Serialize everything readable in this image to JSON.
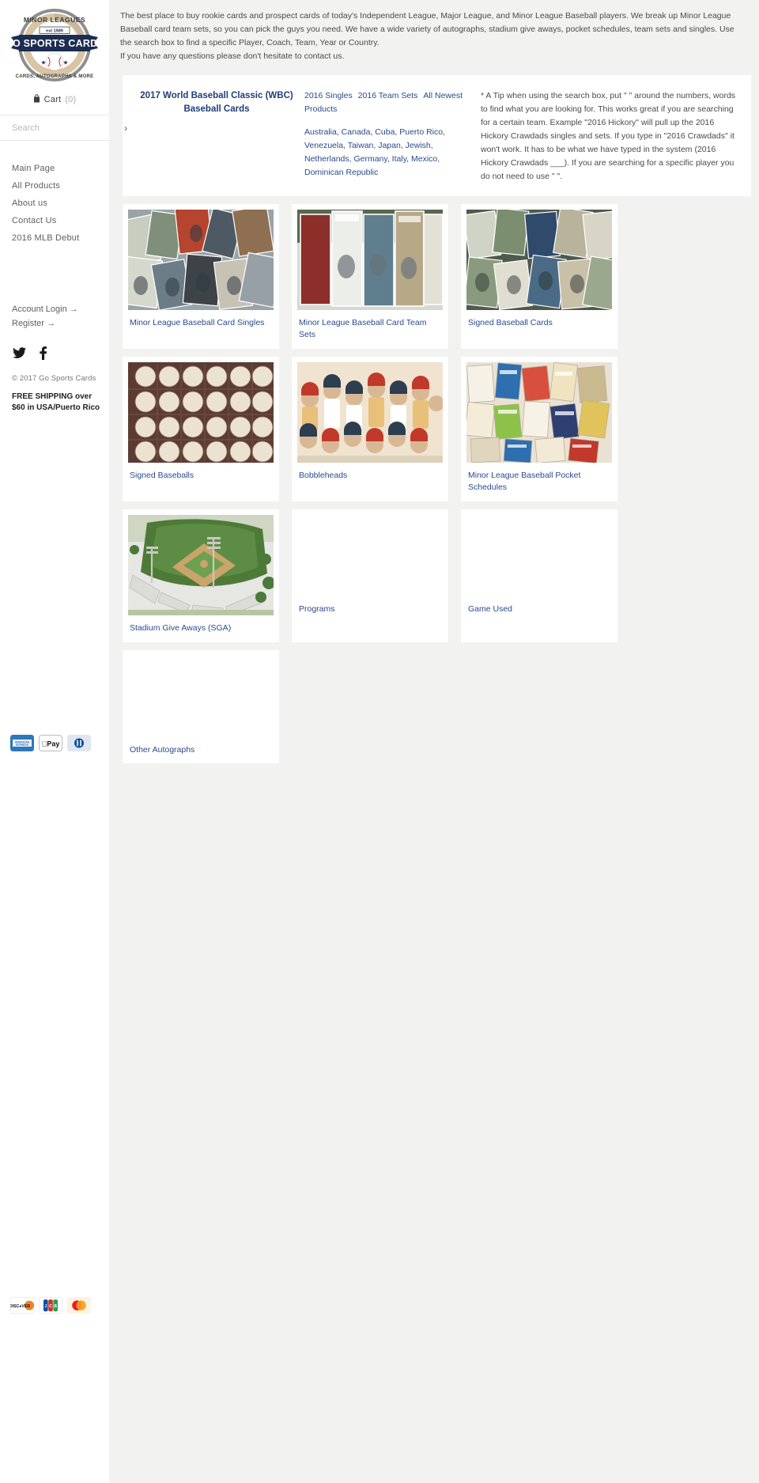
{
  "sidebar": {
    "logo": {
      "top_arc": "MINOR LEAGUES",
      "est": "est 1989",
      "name": "GO SPORTS CARDS",
      "bottom_arc": "CARDS, AUTOGRAPHS & MORE"
    },
    "cart": {
      "label": "Cart",
      "count": "(0)",
      "icon": "shopping-bag-icon"
    },
    "search": {
      "placeholder": "Search",
      "value": "",
      "go_icon": "chevron-right-icon"
    },
    "nav": [
      {
        "label": "Main Page"
      },
      {
        "label": "All Products"
      },
      {
        "label": "About us"
      },
      {
        "label": "Contact Us"
      },
      {
        "label": "2016 MLB Debut"
      }
    ],
    "account": [
      {
        "label": "Account Login →"
      },
      {
        "label": "Register →"
      }
    ],
    "social": [
      {
        "name": "twitter-icon"
      },
      {
        "name": "facebook-icon"
      }
    ],
    "copyright": "© 2017 Go Sports Cards",
    "shipping": "FREE SHIPPING over $60 in USA/Puerto Rico",
    "payments_row1": [
      {
        "name": "american-express-icon",
        "label": "AMERICAN EXPRESS"
      },
      {
        "name": "apple-pay-icon",
        "label": "Pay"
      },
      {
        "name": "diners-club-icon",
        "label": "Diners Club"
      }
    ],
    "payments_row2": [
      {
        "name": "discover-icon",
        "label": "DISCOVER"
      },
      {
        "name": "jcb-icon",
        "label": "JCB"
      },
      {
        "name": "mastercard-icon",
        "label": "Mastercard"
      }
    ]
  },
  "intro": {
    "line1": "The best place to buy rookie cards and prospect cards of today's Independent League, Major League, and Minor League Baseball players. We break up Minor League Baseball card team sets, so you can pick the guys you need. We have a wide variety of autographs, stadium give aways, pocket schedules, team sets and singles. Use the search box to find a specific Player, Coach, Team, Year or Country.",
    "line2": "If you have any questions please don't hesitate to contact us."
  },
  "panel": {
    "feature_link": "2017 World Baseball Classic (WBC) Baseball Cards",
    "quick_links": [
      {
        "label": "2016 Singles"
      },
      {
        "label": "2016 Team Sets"
      },
      {
        "label": "All Newest Products"
      }
    ],
    "countries": "Australia, Canada, Cuba, Puerto Rico, Venezuela, Taiwan, Japan, Jewish, Netherlands, Germany, Italy, Mexico, Dominican Republic",
    "tip": "* A Tip when using the search box, put \" \" around the numbers, words to find what you are looking for. This works great if you are searching for a certain team.  Example \"2016 Hickory\" will pull up the 2016 Hickory Crawdads singles and sets. If you type in \"2016 Crawdads\" it won't work. It has to be what we have typed in the system (2016 Hickory Crawdads ___). If you are searching for a specific player you do not need to use \" \"."
  },
  "grid": {
    "items": [
      {
        "title": "Minor League Baseball Card Singles",
        "image": "baseball-cards-pile",
        "has_image": true
      },
      {
        "title": "Minor League Baseball Card Team Sets",
        "image": "graded-cards-stack",
        "has_image": true
      },
      {
        "title": "Signed Baseball Cards",
        "image": "signed-cards-spread",
        "has_image": true
      },
      {
        "title": "Signed Baseballs",
        "image": "signed-baseballs-case",
        "has_image": true
      },
      {
        "title": "Bobbleheads",
        "image": "bobblehead-collection",
        "has_image": true
      },
      {
        "title": "Minor League Baseball Pocket Schedules",
        "image": "pocket-schedules",
        "has_image": true
      },
      {
        "title": "Stadium Give Aways (SGA)",
        "image": "baseball-stadium",
        "has_image": true
      },
      {
        "title": "Programs",
        "image": "",
        "has_image": false
      },
      {
        "title": "Game Used",
        "image": "",
        "has_image": false
      },
      {
        "title": "Other Autographs",
        "image": "",
        "has_image": false
      }
    ]
  },
  "colors": {
    "page_bg": "#f2f2f0",
    "panel_bg": "#ffffff",
    "link_blue": "#2a4a8b",
    "heading_blue": "#1f3d7a",
    "text_gray": "#4a4a4a"
  }
}
